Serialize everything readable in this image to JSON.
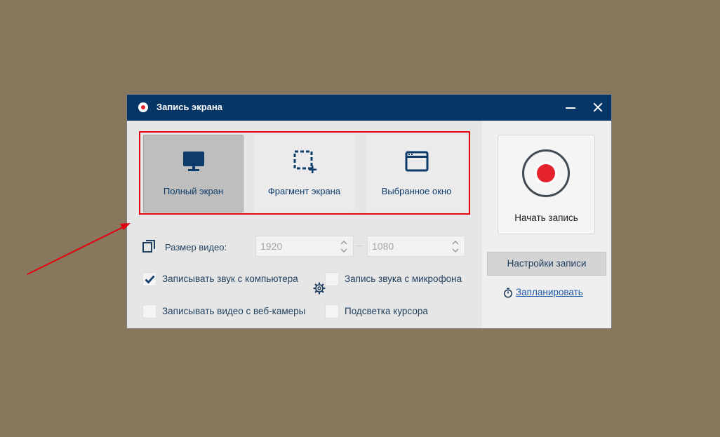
{
  "window": {
    "title": "Запись экрана"
  },
  "modes": [
    {
      "label": "Полный экран",
      "icon": "monitor-icon",
      "active": true
    },
    {
      "label": "Фрагмент экрана",
      "icon": "region-select-icon",
      "active": false
    },
    {
      "label": "Выбранное окно",
      "icon": "window-icon",
      "active": false
    }
  ],
  "video_size": {
    "label": "Размер видео:",
    "width": "1920",
    "height": "1080"
  },
  "options": {
    "record_computer_sound": {
      "label": "Записывать звук с компьютера",
      "checked": true
    },
    "record_microphone": {
      "label": "Запись звука с микрофона",
      "checked": false
    },
    "record_webcam": {
      "label": "Записывать видео с веб-камеры",
      "checked": false
    },
    "cursor_highlight": {
      "label": "Подсветка курсора",
      "checked": false
    }
  },
  "record": {
    "label": "Начать запись"
  },
  "settings_button": "Настройки записи",
  "schedule_link": "Запланировать",
  "colors": {
    "titlebar": "#063665",
    "record_red": "#e4232c",
    "annotation_red": "#e3000f",
    "desktop": "#87785d"
  }
}
